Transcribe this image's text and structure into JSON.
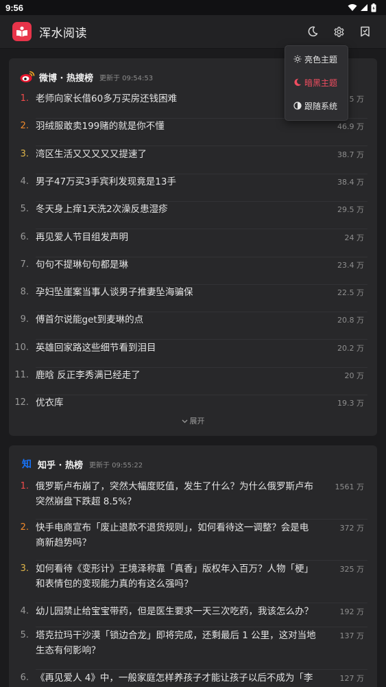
{
  "status": {
    "time": "9:56"
  },
  "app": {
    "title": "浑水阅读"
  },
  "theme_menu": {
    "items": [
      {
        "label": "亮色主题",
        "active": false
      },
      {
        "label": "暗黑主题",
        "active": true
      },
      {
        "label": "跟随系统",
        "active": false
      }
    ]
  },
  "weibo": {
    "source": "微博 · 热搜榜",
    "updated": "更新于 09:54:53",
    "expand_label": "展开",
    "items": [
      {
        "rank": "1.",
        "title": "老师向家长借60多万买房还钱困难",
        "heat": "5 万"
      },
      {
        "rank": "2.",
        "title": "羽绒服敢卖199赌的就是你不懂",
        "heat": "46.9 万"
      },
      {
        "rank": "3.",
        "title": "湾区生活又又又又又提速了",
        "heat": "38.7 万"
      },
      {
        "rank": "4.",
        "title": "男子47万买3手宾利发现竟是13手",
        "heat": "38.4 万"
      },
      {
        "rank": "5.",
        "title": "冬天身上痒1天洗2次澡反患湿疹",
        "heat": "29.5 万"
      },
      {
        "rank": "6.",
        "title": "再见爱人节目组发声明",
        "heat": "24 万"
      },
      {
        "rank": "7.",
        "title": "句句不提琳句句都是琳",
        "heat": "23.4 万"
      },
      {
        "rank": "8.",
        "title": "孕妇坠崖案当事人谈男子推妻坠海骗保",
        "heat": "22.5 万"
      },
      {
        "rank": "9.",
        "title": "傅首尔说能get到麦琳的点",
        "heat": "20.8 万"
      },
      {
        "rank": "10.",
        "title": "英雄回家路这些细节看到泪目",
        "heat": "20.2 万"
      },
      {
        "rank": "11.",
        "title": "鹿晗 反正李秀满已经走了",
        "heat": "20 万"
      },
      {
        "rank": "12.",
        "title": "优衣库",
        "heat": "19.3 万"
      }
    ]
  },
  "zhihu": {
    "logo_text": "知",
    "source": "知乎 · 热榜",
    "updated": "更新于 09:55:22",
    "items": [
      {
        "rank": "1.",
        "title": "俄罗斯卢布崩了，突然大幅度贬值，发生了什么？为什么俄罗斯卢布突然崩盘下跌超 8.5%？",
        "heat": "1561 万"
      },
      {
        "rank": "2.",
        "title": "快手电商宣布「废止退款不退货规则」，如何看待这一调整？会是电商新趋势吗？",
        "heat": "372 万"
      },
      {
        "rank": "3.",
        "title": "如何看待《变形计》王境泽称靠「真香」版权年入百万？人物「梗」和表情包的变现能力真的有这么强吗？",
        "heat": "325 万"
      },
      {
        "rank": "4.",
        "title": "幼儿园禁止给宝宝带药，但是医生要求一天三次吃药，我该怎么办？",
        "heat": "192 万"
      },
      {
        "rank": "5.",
        "title": "塔克拉玛干沙漠「锁边合龙」即将完成，还剩最后 1 公里，这对当地生态有何影响？",
        "heat": "137 万"
      },
      {
        "rank": "6.",
        "title": "《再见爱人 4》中，一般家庭怎样养孩子才能让孩子以后不成为「李",
        "heat": "127 万"
      }
    ]
  }
}
